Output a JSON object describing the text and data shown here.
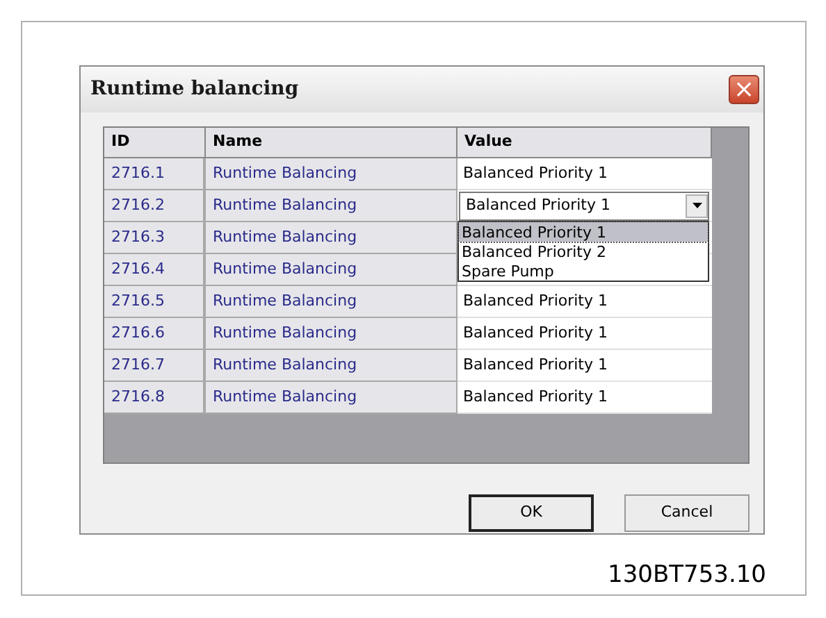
{
  "dialog": {
    "title": "Runtime balancing",
    "close": "×"
  },
  "table": {
    "columns": [
      "ID",
      "Name",
      "Value"
    ],
    "rows": [
      {
        "id": "2716.1",
        "name": "Runtime Balancing",
        "value": "Balanced Priority 1",
        "kind": "text"
      },
      {
        "id": "2716.2",
        "name": "Runtime Balancing",
        "value": "Balanced Priority 1",
        "kind": "dropdown",
        "expanded": true
      },
      {
        "id": "2716.3",
        "name": "Runtime Balancing",
        "kind": "hidden"
      },
      {
        "id": "2716.4",
        "name": "Runtime Balancing",
        "kind": "hidden"
      },
      {
        "id": "2716.5",
        "name": "Runtime Balancing",
        "value": "Balanced Priority 1",
        "kind": "text"
      },
      {
        "id": "2716.6",
        "name": "Runtime Balancing",
        "value": "Balanced Priority 1",
        "kind": "text"
      },
      {
        "id": "2716.7",
        "name": "Runtime Balancing",
        "value": "Balanced Priority 1",
        "kind": "text"
      },
      {
        "id": "2716.8",
        "name": "Runtime Balancing",
        "value": "Balanced Priority 1",
        "kind": "text"
      }
    ]
  },
  "dropdown_options": [
    {
      "label": "Balanced Priority 1",
      "selected": true
    },
    {
      "label": "Balanced Priority 2",
      "selected": false
    },
    {
      "label": "Spare Pump",
      "selected": false
    }
  ],
  "buttons": [
    "OK",
    "Cancel"
  ],
  "figure_code": "130BT753.10"
}
